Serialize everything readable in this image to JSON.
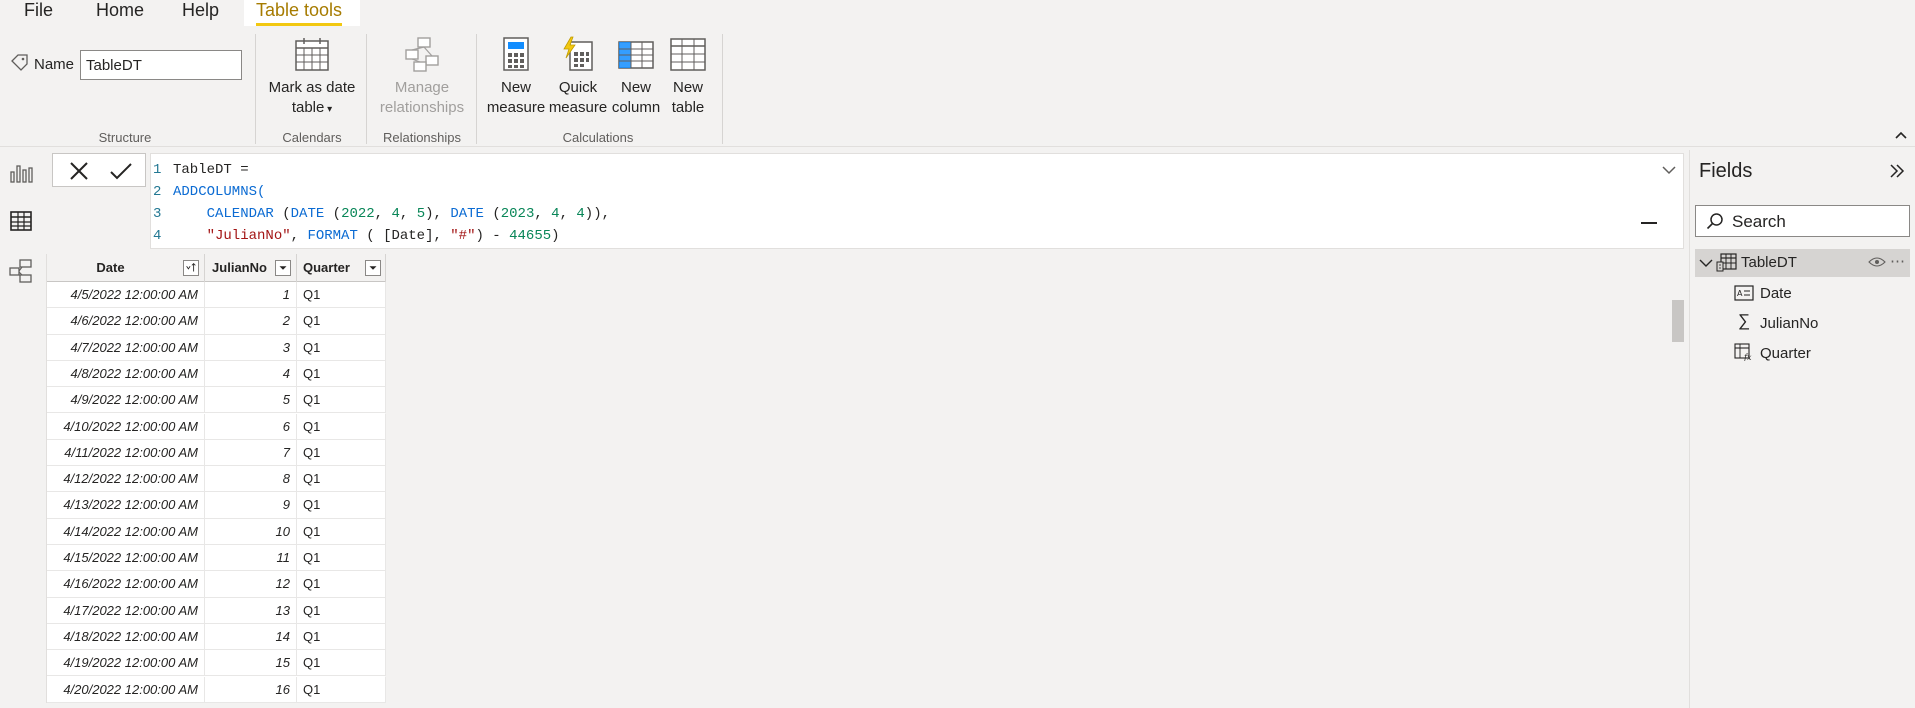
{
  "menu": {
    "file": "File",
    "home": "Home",
    "help": "Help",
    "table_tools": "Table tools"
  },
  "ribbon": {
    "name_label": "Name",
    "name_value": "TableDT",
    "mark_as_date_line1": "Mark as date",
    "mark_as_date_line2": "table",
    "manage_line1": "Manage",
    "manage_line2": "relationships",
    "new_measure_line1": "New",
    "new_measure_line2": "measure",
    "quick_measure_line1": "Quick",
    "quick_measure_line2": "measure",
    "new_column_line1": "New",
    "new_column_line2": "column",
    "new_table_line1": "New",
    "new_table_line2": "table",
    "groups": {
      "structure": "Structure",
      "calendars": "Calendars",
      "relationships": "Relationships",
      "calculations": "Calculations"
    }
  },
  "formula": {
    "lines": [
      {
        "n": "1",
        "parts": [
          {
            "t": "TableDT =",
            "c": "plain"
          }
        ]
      },
      {
        "n": "2",
        "parts": [
          {
            "t": "ADDCOLUMNS(",
            "c": "kw"
          }
        ]
      },
      {
        "n": "3",
        "parts": [
          {
            "t": "    CALENDAR",
            "c": "kw"
          },
          {
            "t": " (",
            "c": "plain"
          },
          {
            "t": "DATE",
            "c": "kw"
          },
          {
            "t": " (",
            "c": "plain"
          },
          {
            "t": "2022",
            "c": "num"
          },
          {
            "t": ", ",
            "c": "plain"
          },
          {
            "t": "4",
            "c": "num"
          },
          {
            "t": ", ",
            "c": "plain"
          },
          {
            "t": "5",
            "c": "num"
          },
          {
            "t": "), ",
            "c": "plain"
          },
          {
            "t": "DATE",
            "c": "kw"
          },
          {
            "t": " (",
            "c": "plain"
          },
          {
            "t": "2023",
            "c": "num"
          },
          {
            "t": ", ",
            "c": "plain"
          },
          {
            "t": "4",
            "c": "num"
          },
          {
            "t": ", ",
            "c": "plain"
          },
          {
            "t": "4",
            "c": "num"
          },
          {
            "t": ")),",
            "c": "plain"
          }
        ]
      },
      {
        "n": "4",
        "parts": [
          {
            "t": "    \"JulianNo\"",
            "c": "str"
          },
          {
            "t": ", ",
            "c": "plain"
          },
          {
            "t": "FORMAT",
            "c": "kw"
          },
          {
            "t": " ( [Date], ",
            "c": "plain"
          },
          {
            "t": "\"#\"",
            "c": "str"
          },
          {
            "t": ") - ",
            "c": "plain"
          },
          {
            "t": "44655",
            "c": "num"
          },
          {
            "t": ")",
            "c": "plain"
          }
        ]
      }
    ]
  },
  "table": {
    "columns": [
      "Date",
      "JulianNo",
      "Quarter"
    ],
    "rows": [
      [
        "4/5/2022 12:00:00 AM",
        "1",
        "Q1"
      ],
      [
        "4/6/2022 12:00:00 AM",
        "2",
        "Q1"
      ],
      [
        "4/7/2022 12:00:00 AM",
        "3",
        "Q1"
      ],
      [
        "4/8/2022 12:00:00 AM",
        "4",
        "Q1"
      ],
      [
        "4/9/2022 12:00:00 AM",
        "5",
        "Q1"
      ],
      [
        "4/10/2022 12:00:00 AM",
        "6",
        "Q1"
      ],
      [
        "4/11/2022 12:00:00 AM",
        "7",
        "Q1"
      ],
      [
        "4/12/2022 12:00:00 AM",
        "8",
        "Q1"
      ],
      [
        "4/13/2022 12:00:00 AM",
        "9",
        "Q1"
      ],
      [
        "4/14/2022 12:00:00 AM",
        "10",
        "Q1"
      ],
      [
        "4/15/2022 12:00:00 AM",
        "11",
        "Q1"
      ],
      [
        "4/16/2022 12:00:00 AM",
        "12",
        "Q1"
      ],
      [
        "4/17/2022 12:00:00 AM",
        "13",
        "Q1"
      ],
      [
        "4/18/2022 12:00:00 AM",
        "14",
        "Q1"
      ],
      [
        "4/19/2022 12:00:00 AM",
        "15",
        "Q1"
      ],
      [
        "4/20/2022 12:00:00 AM",
        "16",
        "Q1"
      ]
    ]
  },
  "fields": {
    "title": "Fields",
    "search_placeholder": "Search",
    "table_name": "TableDT",
    "items": [
      "Date",
      "JulianNo",
      "Quarter"
    ]
  },
  "colors": {
    "accent": "#f2c811",
    "active_tab_text": "#a67b00",
    "keyword": "#0b6bd3",
    "number": "#098658",
    "string": "#a31515",
    "selected_row": "#d6d4d2"
  }
}
